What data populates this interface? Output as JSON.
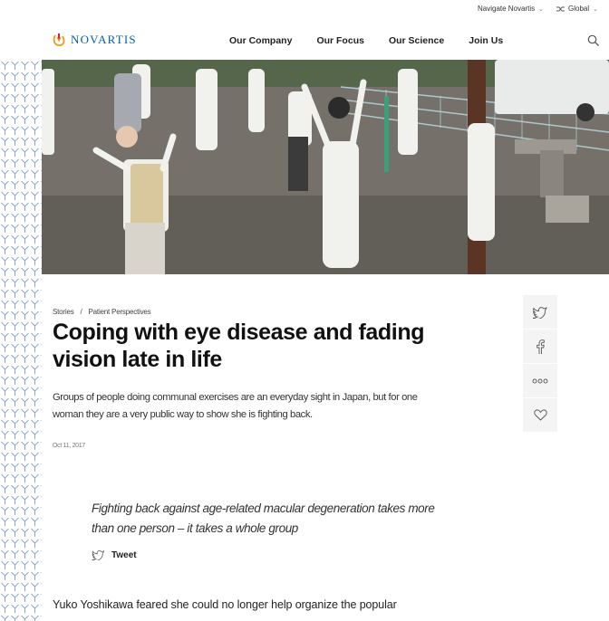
{
  "utility": {
    "navigate_label": "Navigate Novartis",
    "global_label": "Global"
  },
  "header": {
    "logo_text": "NOVARTIS",
    "nav": [
      {
        "label": "Our Company"
      },
      {
        "label": "Our Focus"
      },
      {
        "label": "Our Science"
      },
      {
        "label": "Join Us"
      }
    ]
  },
  "hero": {
    "icon": "photo-of-elderly-group-exercising"
  },
  "article": {
    "breadcrumb": [
      "Stories",
      "/",
      "Patient Perspectives"
    ],
    "title": "Coping with eye disease and fading vision late in life",
    "lede": "Groups of people doing communal exercises are an everyday sight in Japan, but for one woman they are a very public way to show she is fighting back.",
    "date": "Oct 11, 2017",
    "quote": "Fighting back against age-related macular degeneration takes more than one person – it takes a whole group",
    "tweet_label": "Tweet",
    "body_start": "Yuko Yoshikawa feared she could no longer help organize the popular"
  },
  "share": {
    "buttons": [
      {
        "icon": "twitter-icon"
      },
      {
        "icon": "facebook-icon"
      },
      {
        "icon": "more-icon"
      },
      {
        "icon": "heart-icon"
      }
    ]
  },
  "colors": {
    "brand_blue": "#0460a9",
    "brand_orange": "#ec9a1e",
    "share_bg": "#f4f4f4",
    "pattern_blue": "#6b8fc4"
  }
}
